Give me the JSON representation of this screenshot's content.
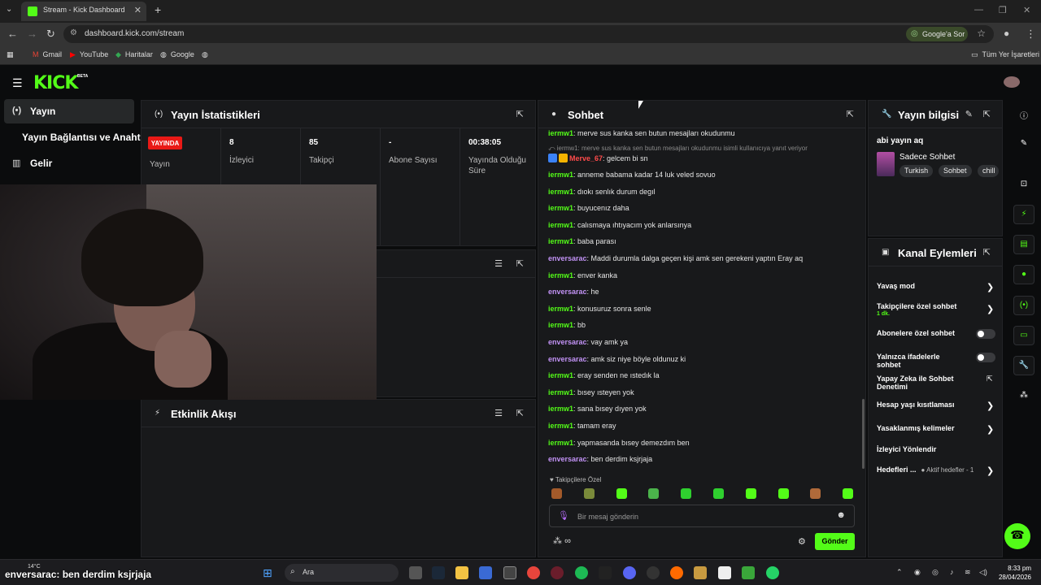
{
  "browser": {
    "tab_title": "Stream - Kick Dashboard",
    "url": "dashboard.kick.com/stream",
    "google_ask": "Google'a Sor",
    "bookmarks": [
      "Gmail",
      "YouTube",
      "Haritalar",
      "Google"
    ],
    "all_bookmarks": "Tüm Yer İşaretleri"
  },
  "header": {
    "logo": "KICK",
    "beta": "BETA"
  },
  "sidebar": {
    "items": [
      {
        "label": "Yayın",
        "icon": "broadcast-icon"
      },
      {
        "label": "Yayın Bağlantısı ve Anahtarı",
        "icon": ""
      },
      {
        "label": "Gelir",
        "icon": "chart-icon"
      }
    ]
  },
  "stats": {
    "title": "Yayın İstatistikleri",
    "live_badge": "YAYINDA",
    "columns": [
      {
        "value": "",
        "label": "Yayın"
      },
      {
        "value": "8",
        "label": "İzleyici"
      },
      {
        "value": "85",
        "label": "Takipçi"
      },
      {
        "value": "-",
        "label": "Abone Sayısı"
      },
      {
        "value": "00:38:05",
        "label": "Yayında Olduğu Süre"
      }
    ]
  },
  "activity": {
    "title": "Etkinlik Akışı"
  },
  "chat": {
    "title": "Sohbet",
    "messages": [
      {
        "user": "iermw1",
        "text": ": merve sus kanka sen butun mesajları okudunmu",
        "cls": "u1"
      },
      {
        "user": "",
        "text": "⤺ iermw1: merve sus kanka sen butun mesajları okudunmu isimli kullanıcıya yanıt veriyor",
        "cls": "reply"
      },
      {
        "user": "Merve_67",
        "text": ": gelcem bi sn",
        "cls": "u3"
      },
      {
        "user": "iermw1",
        "text": ": anneme babama kadar 14 luk veled sovuo",
        "cls": "u1"
      },
      {
        "user": "iermw1",
        "text": ": dıokı senlık durum degıl",
        "cls": "u1"
      },
      {
        "user": "iermw1",
        "text": ": buyucenız daha",
        "cls": "u1"
      },
      {
        "user": "iermw1",
        "text": ": calısmaya ıhtıyacım yok anlarsınya",
        "cls": "u1"
      },
      {
        "user": "iermw1",
        "text": ": baba parası",
        "cls": "u1"
      },
      {
        "user": "enversarac",
        "text": ": Maddi durumla dalga geçen kişi amk sen gerekeni yaptın Eray aq",
        "cls": "u2"
      },
      {
        "user": "iermw1",
        "text": ": enver kanka",
        "cls": "u1"
      },
      {
        "user": "enversarac",
        "text": ": he",
        "cls": "u2"
      },
      {
        "user": "iermw1",
        "text": ": konusuruz sonra senle",
        "cls": "u1"
      },
      {
        "user": "iermw1",
        "text": ": bb",
        "cls": "u1"
      },
      {
        "user": "enversarac",
        "text": ": vay amk ya",
        "cls": "u2"
      },
      {
        "user": "enversarac",
        "text": ": amk siz niye böyle oldunuz ki",
        "cls": "u2"
      },
      {
        "user": "iermw1",
        "text": ": eray senden ne ıstedık la",
        "cls": "u1"
      },
      {
        "user": "iermw1",
        "text": ": bısey ısteyen yok",
        "cls": "u1"
      },
      {
        "user": "iermw1",
        "text": ": sana bısey dıyen yok",
        "cls": "u1"
      },
      {
        "user": "iermw1",
        "text": ": tamam eray",
        "cls": "u1"
      },
      {
        "user": "iermw1",
        "text": ": yapmasanda bısey demezdım ben",
        "cls": "u1"
      },
      {
        "user": "enversarac",
        "text": ": ben derdim ksjrjaja",
        "cls": "u2"
      }
    ],
    "followers_only": "♥ Takipçilere Özel",
    "placeholder": "Bir mesaj gönderin",
    "send": "Gönder",
    "points": "∞"
  },
  "stream_info": {
    "title": "Yayın bilgisi",
    "stream_title": "abi yayın aq",
    "category": "Sadece Sohbet",
    "tags": [
      "Turkish",
      "Sohbet",
      "chill"
    ]
  },
  "channel_actions": {
    "title": "Kanal Eylemleri",
    "items": [
      {
        "label": "Yavaş mod",
        "sub": "",
        "control": "chevron"
      },
      {
        "label": "Takipçilere özel sohbet",
        "sub": "1 dk.",
        "control": "chevron"
      },
      {
        "label": "Abonelere özel sohbet",
        "sub": "",
        "control": "toggle"
      },
      {
        "label": "Yalnızca ifadelerle sohbet",
        "sub": "",
        "control": "toggle"
      },
      {
        "label": "Yapay Zeka ile Sohbet Denetimi",
        "sub": "",
        "control": "external"
      },
      {
        "label": "Hesap yaşı kısıtlaması",
        "sub": "",
        "control": "chevron"
      },
      {
        "label": "Yasaklanmış kelimeler",
        "sub": "",
        "control": "chevron"
      },
      {
        "label": "İzleyici Yönlendir",
        "sub": "",
        "control": "none"
      },
      {
        "label": "Hedefleri ...",
        "sub": "● Aktif hedefler - 1",
        "control": "chevron"
      }
    ]
  },
  "overlay": {
    "caption": "enversarac: ben derdim ksjrjaja"
  },
  "taskbar": {
    "weather": "14°C",
    "search": "Ara",
    "time": "8:33 pm",
    "date": "28/04/2026"
  },
  "colors": {
    "accent": "#53fc18",
    "live": "#e91916",
    "user_alt": "#c292f5"
  }
}
